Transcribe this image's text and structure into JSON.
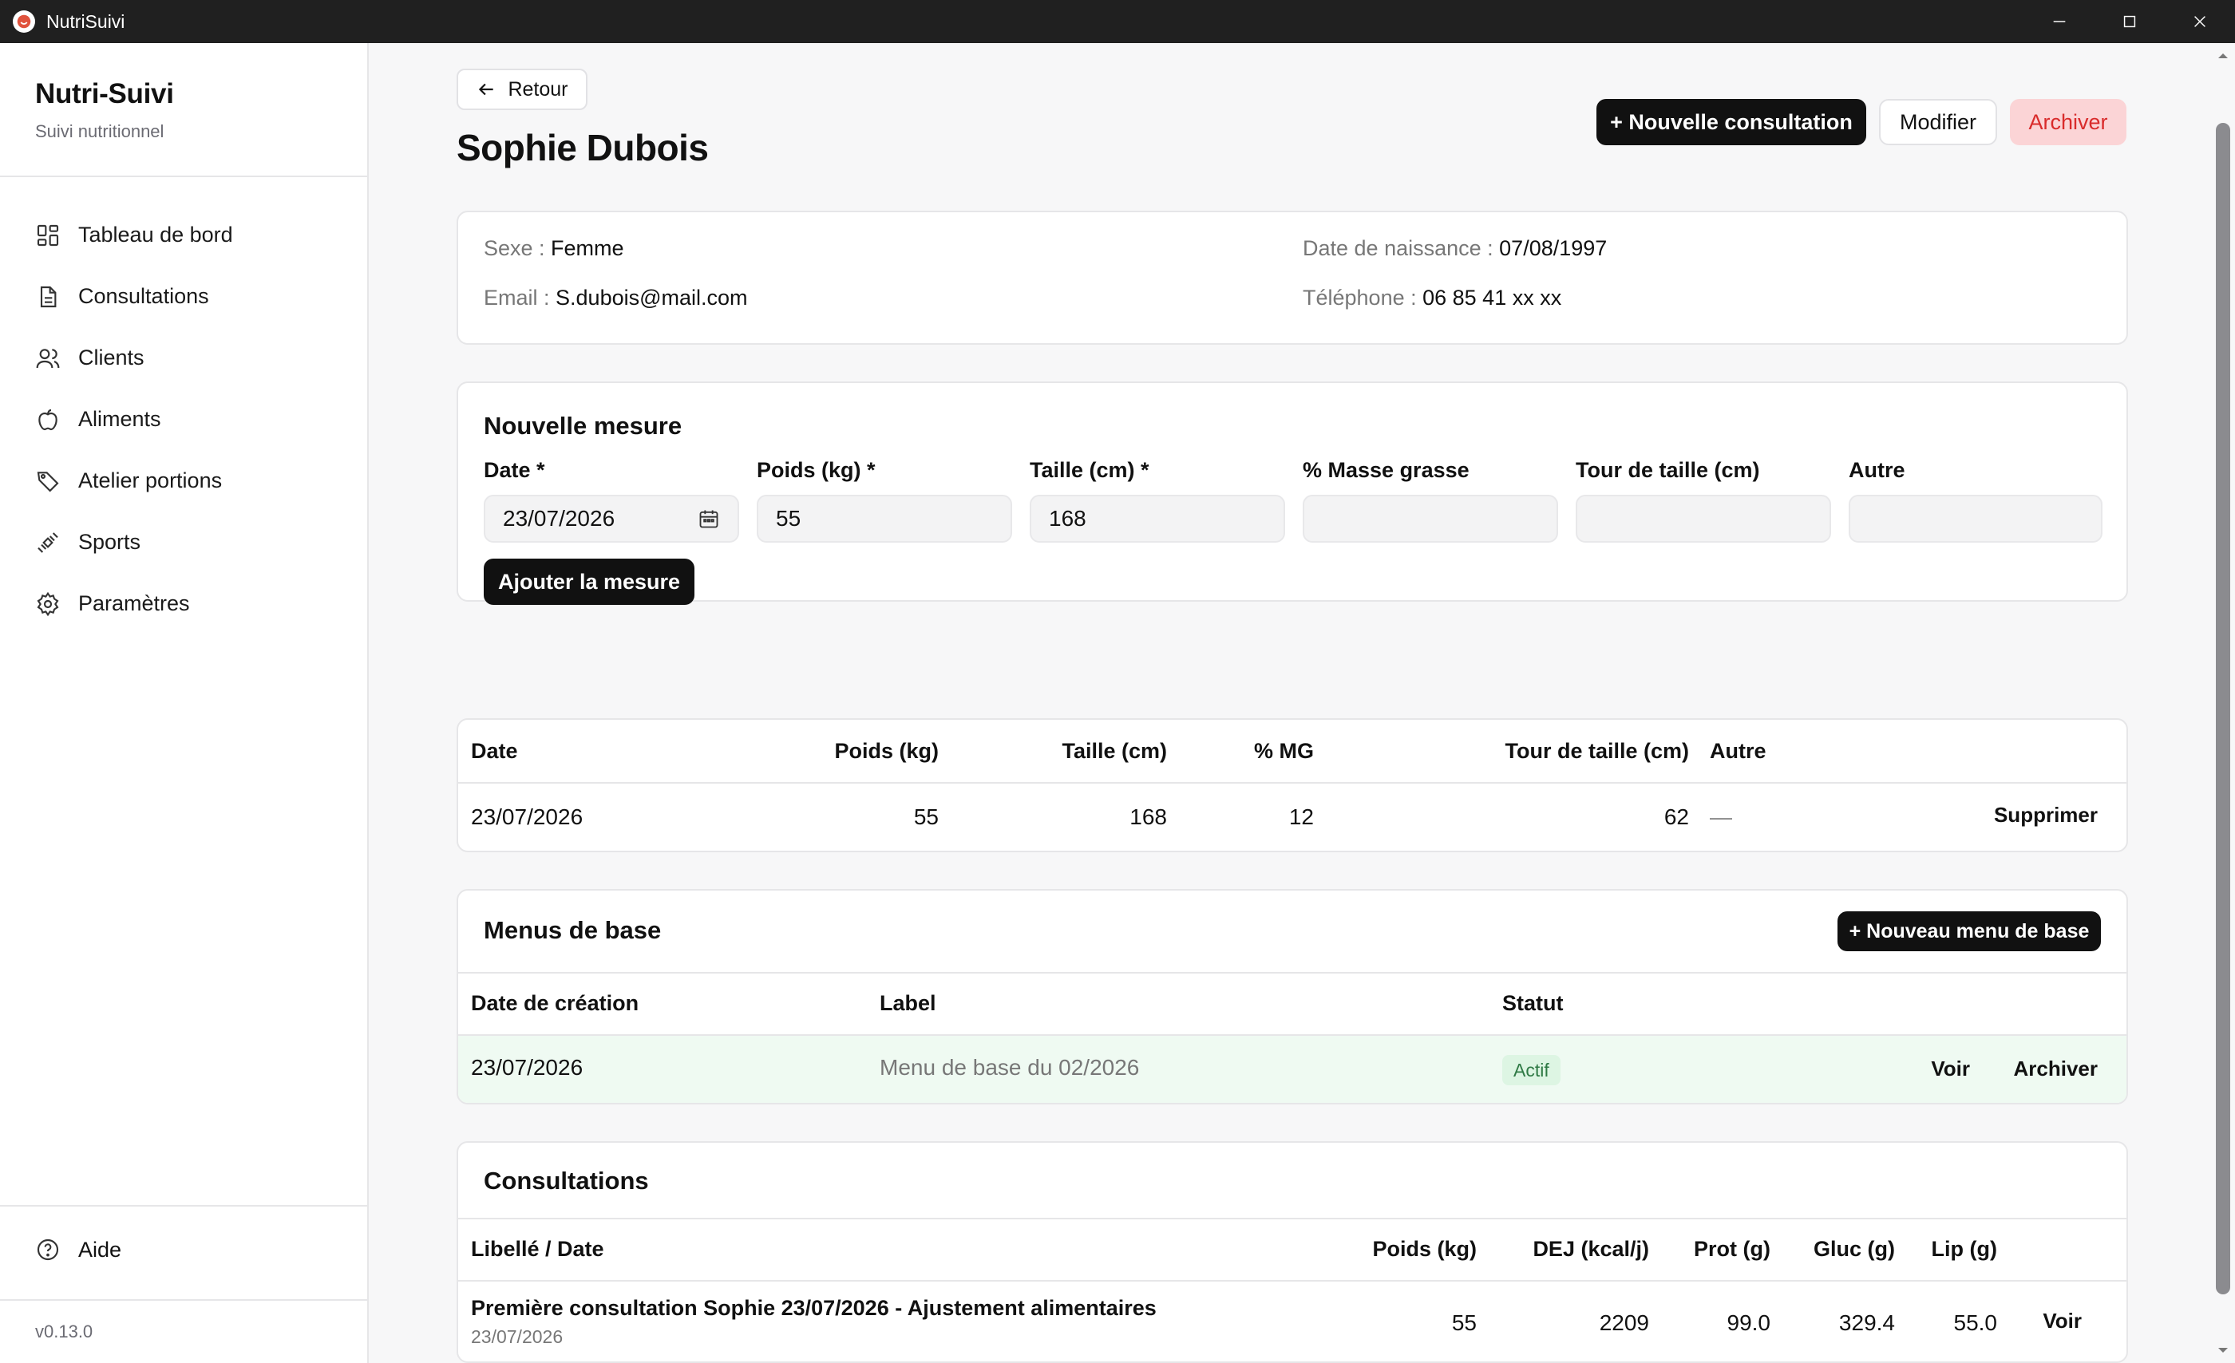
{
  "window": {
    "title": "NutriSuivi"
  },
  "sidebar": {
    "brand_title": "Nutri-Suivi",
    "brand_subtitle": "Suivi nutritionnel",
    "items": [
      {
        "label": "Tableau de bord",
        "icon": "dashboard-icon"
      },
      {
        "label": "Consultations",
        "icon": "document-icon"
      },
      {
        "label": "Clients",
        "icon": "users-icon"
      },
      {
        "label": "Aliments",
        "icon": "apple-icon"
      },
      {
        "label": "Atelier portions",
        "icon": "tag-icon"
      },
      {
        "label": "Sports",
        "icon": "dumbbell-icon"
      },
      {
        "label": "Paramètres",
        "icon": "gear-icon"
      }
    ],
    "help_label": "Aide",
    "version": "v0.13.0"
  },
  "header": {
    "back_label": "Retour",
    "title": "Sophie Dubois",
    "new_consult_label": "+ Nouvelle consultation",
    "edit_label": "Modifier",
    "archive_label": "Archiver"
  },
  "client_info": {
    "sex_label": "Sexe : ",
    "sex": "Femme",
    "email_label": "Email : ",
    "email": "S.dubois@mail.com",
    "birth_label": "Date de naissance : ",
    "birth": "07/08/1997",
    "phone_label": "Téléphone : ",
    "phone": "06 85 41 xx xx"
  },
  "new_measure": {
    "title": "Nouvelle mesure",
    "fields": [
      {
        "label": "Date *",
        "value": "23/07/2026"
      },
      {
        "label": "Poids (kg) *",
        "value": "55"
      },
      {
        "label": "Taille (cm) *",
        "value": "168"
      },
      {
        "label": "% Masse grasse",
        "value": ""
      },
      {
        "label": "Tour de taille (cm)",
        "value": ""
      },
      {
        "label": "Autre",
        "value": ""
      }
    ],
    "submit_label": "Ajouter la mesure"
  },
  "measures_table": {
    "headers": [
      "Date",
      "Poids (kg)",
      "Taille (cm)",
      "% MG",
      "Tour de taille (cm)",
      "Autre"
    ],
    "rows": [
      {
        "date": "23/07/2026",
        "poids": "55",
        "taille": "168",
        "mg": "12",
        "tour": "62",
        "autre": "—",
        "action": "Supprimer"
      }
    ]
  },
  "base_menus": {
    "title": "Menus de base",
    "new_label": "+ Nouveau menu de base",
    "headers": [
      "Date de création",
      "Label",
      "Statut"
    ],
    "rows": [
      {
        "date": "23/07/2026",
        "label": "Menu de base du 02/2026",
        "status": "Actif",
        "view": "Voir",
        "archive": "Archiver"
      }
    ]
  },
  "consultations": {
    "title": "Consultations",
    "headers": [
      "Libellé / Date",
      "Poids (kg)",
      "DEJ (kcal/j)",
      "Prot (g)",
      "Gluc (g)",
      "Lip (g)"
    ],
    "rows": [
      {
        "label": "Première consultation Sophie 23/07/2026 - Ajustement alimentaires",
        "date": "23/07/2026",
        "poids": "55",
        "dej": "2209",
        "prot": "99.0",
        "gluc": "329.4",
        "lip": "55.0",
        "view": "Voir"
      }
    ]
  }
}
